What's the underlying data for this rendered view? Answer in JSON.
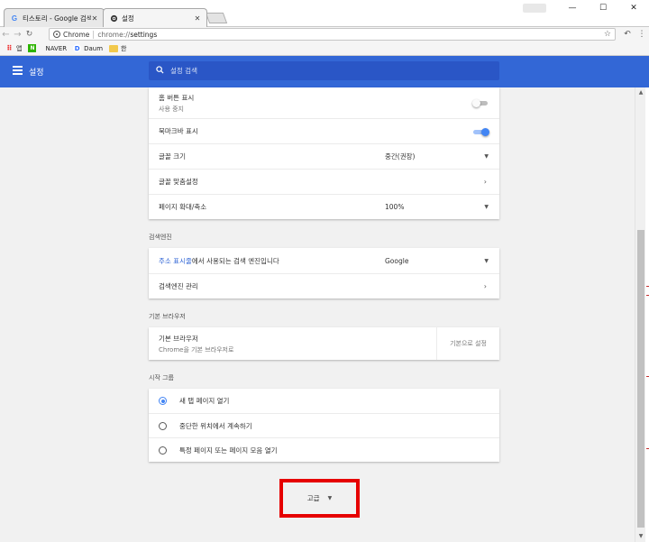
{
  "tabs": [
    {
      "title": "티스토리 - Google 검색",
      "favicon": "google-icon",
      "active": false
    },
    {
      "title": "설정",
      "favicon": "gear-icon",
      "active": true
    }
  ],
  "window_controls": {
    "minimize": "—",
    "maximize": "☐",
    "close": "✕"
  },
  "address_bar": {
    "chip": "Chrome",
    "url_scheme": "chrome://",
    "url_path": "settings"
  },
  "bookmarks": [
    {
      "label": "앱",
      "icon": "apps-icon"
    },
    {
      "label": "",
      "icon": "naver-n-icon"
    },
    {
      "label": "NAVER",
      "icon": ""
    },
    {
      "label": "Daum",
      "icon": "daum-icon"
    },
    {
      "label": "한",
      "icon": "folder-icon"
    }
  ],
  "header": {
    "title": "설정",
    "search_placeholder": "설정 검색",
    "accent": "#3367d6"
  },
  "appearance": {
    "home_button_label": "홈 버튼 표시",
    "home_button_sub": "사용 중지",
    "home_button_on": false,
    "bookmarks_bar_label": "북마크바 표시",
    "bookmarks_bar_on": true,
    "font_size_label": "글꼴 크기",
    "font_size_value": "중간(권장)",
    "custom_fonts_label": "글꼴 맞춤설정",
    "zoom_label": "페이지 확대/축소",
    "zoom_value": "100%"
  },
  "search_engine": {
    "section_title": "검색엔진",
    "row_link": "주소 표시줄",
    "row_text": "에서 사용되는 검색 엔진입니다",
    "value": "Google",
    "manage_label": "검색엔진 관리"
  },
  "default_browser": {
    "section_title": "기본 브라우저",
    "label": "기본 브라우저",
    "sub": "Chrome을 기본 브라우저로",
    "button": "기본으로 설정"
  },
  "startup": {
    "section_title": "시작 그룹",
    "options": [
      {
        "label": "새 탭 페이지 열기",
        "checked": true
      },
      {
        "label": "중단한 위치에서 계속하기",
        "checked": false
      },
      {
        "label": "특정 페이지 또는 페이지 모음 열기",
        "checked": false
      }
    ]
  },
  "advanced": {
    "label": "고급",
    "highlight_color": "#e60000"
  }
}
